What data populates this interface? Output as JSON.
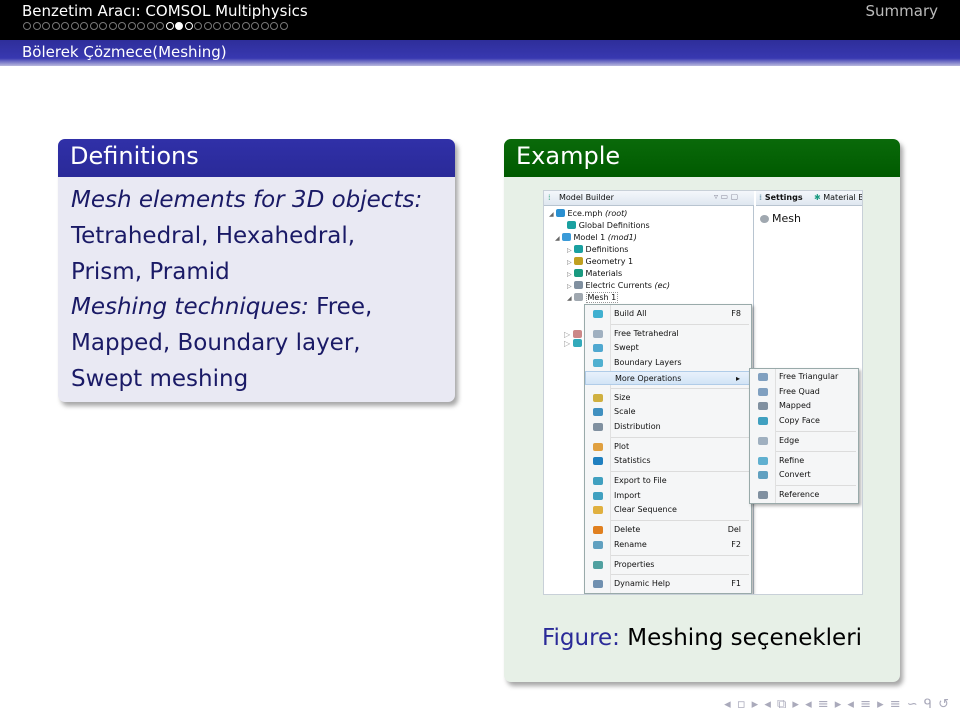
{
  "header": {
    "title": "Benzetim Aracı: COMSOL Multiphysics",
    "summary_link": "Summary",
    "section": "Bölerek Çözmece(Meshing)",
    "nav_dots": {
      "total": 28,
      "current": 16,
      "highlighted": [
        15,
        16,
        17
      ]
    }
  },
  "definitions": {
    "title": "Definitions",
    "line1_italic": "Mesh elements for 3D objects:",
    "line2": "Tetrahedral, Hexahedral,",
    "line3": "Prism, Pramid",
    "line4_italic": "Meshing techniques:",
    "line4_rest": " Free,",
    "line5": "Mapped, Boundary layer,",
    "line6": "Swept meshing"
  },
  "example": {
    "title": "Example",
    "caption_label": "Figure:",
    "caption_text": "Meshing seçenekleri"
  },
  "screenshot": {
    "model_builder_tab": "Model Builder",
    "settings_tab": "Settings",
    "material_tab": "Material Br",
    "settings_heading": "Mesh",
    "tree": [
      {
        "label": "Ece.mph",
        "suffix": "(root)",
        "depth": 0,
        "expander": "expanded",
        "icon_color": "#2a8fd0"
      },
      {
        "label": "Global Definitions",
        "suffix": "",
        "depth": 1,
        "expander": "",
        "icon_color": "#1aa0a0"
      },
      {
        "label": "Model 1",
        "suffix": "(mod1)",
        "depth": 0.5,
        "expander": "expanded",
        "icon_color": "#3a9ad8"
      },
      {
        "label": "Definitions",
        "suffix": "",
        "depth": 1.5,
        "expander": "collapsed",
        "icon_color": "#1aa0a0"
      },
      {
        "label": "Geometry 1",
        "suffix": "",
        "depth": 1.5,
        "expander": "collapsed",
        "icon_color": "#c0a020"
      },
      {
        "label": "Materials",
        "suffix": "",
        "depth": 1.5,
        "expander": "collapsed",
        "icon_color": "#1a9a80"
      },
      {
        "label": "Electric Currents",
        "suffix": "(ec)",
        "depth": 1.5,
        "expander": "collapsed",
        "icon_color": "#8090a0"
      },
      {
        "label": "Mesh 1",
        "suffix": "",
        "depth": 1.5,
        "expander": "expanded",
        "icon_color": "#a0a8b0"
      }
    ],
    "context_menu": [
      {
        "label": "Build All",
        "shortcut": "F8",
        "icon_color": "#40b0d0"
      },
      {
        "sep": true
      },
      {
        "label": "Free Tetrahedral",
        "icon_color": "#a0b0c0"
      },
      {
        "label": "Swept",
        "icon_color": "#50a8d0"
      },
      {
        "label": "Boundary Layers",
        "icon_color": "#50b0d0"
      },
      {
        "label": "More Operations",
        "submenu": true,
        "highlighted": true
      },
      {
        "sep": true
      },
      {
        "label": "Size",
        "icon_color": "#d0b040"
      },
      {
        "label": "Scale",
        "icon_color": "#4090c0"
      },
      {
        "label": "Distribution",
        "icon_color": "#8090a0"
      },
      {
        "sep": true
      },
      {
        "label": "Plot",
        "icon_color": "#e0a040"
      },
      {
        "label": "Statistics",
        "icon_color": "#2080c0"
      },
      {
        "sep": true
      },
      {
        "label": "Export to File",
        "icon_color": "#40a0c0"
      },
      {
        "label": "Import",
        "icon_color": "#40a0c0"
      },
      {
        "label": "Clear Sequence",
        "icon_color": "#e0b040"
      },
      {
        "sep": true
      },
      {
        "label": "Delete",
        "shortcut": "Del",
        "icon_color": "#e08020"
      },
      {
        "label": "Rename",
        "shortcut": "F2",
        "icon_color": "#60a0c0"
      },
      {
        "sep": true
      },
      {
        "label": "Properties",
        "icon_color": "#50a0a0"
      },
      {
        "sep": true
      },
      {
        "label": "Dynamic Help",
        "shortcut": "F1",
        "icon_color": "#7090b0"
      }
    ],
    "submenu": [
      {
        "label": "Free Triangular",
        "icon_color": "#80a0c0"
      },
      {
        "label": "Free Quad",
        "icon_color": "#80a0c0"
      },
      {
        "label": "Mapped",
        "icon_color": "#8090a0"
      },
      {
        "label": "Copy Face",
        "icon_color": "#40a0c0"
      },
      {
        "sep": true
      },
      {
        "label": "Edge",
        "icon_color": "#a0b0c0"
      },
      {
        "sep": true
      },
      {
        "label": "Refine",
        "icon_color": "#60b0d0"
      },
      {
        "label": "Convert",
        "icon_color": "#60a0c0"
      },
      {
        "sep": true
      },
      {
        "label": "Reference",
        "icon_color": "#8090a0"
      }
    ]
  },
  "nav_symbols": "◂ ▫ ▸ ◂ ⧉ ▸ ◂ ≡ ▸ ◂ ≡ ▸ ≡ ∽ ᑫ ↺"
}
